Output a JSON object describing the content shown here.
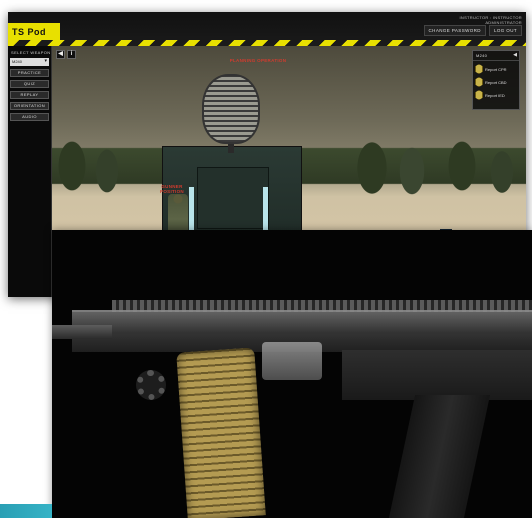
{
  "app": {
    "logo_text": "TS Pod",
    "instructor_label": "INSTRUCTOR : INSTRUCTOR",
    "instructor_sub": "ADMINISTRATOR",
    "links": [
      "CHANGE PASSWORD",
      "LOG OUT"
    ]
  },
  "sidebar": {
    "section_title": "SELECT WEAPON",
    "selected_weapon": "M240",
    "buttons": [
      "PRACTICE",
      "QUIZ",
      "REPLAY",
      "ORIENTATION",
      "AUDIO"
    ]
  },
  "viewport": {
    "callout_top": "PLANNING OPERATION",
    "callout_left": "GUNNER POSITION",
    "info_icon_glyph": "i",
    "back_icon_glyph": "◀"
  },
  "panel": {
    "title": "M240",
    "toggle_glyph": "◀",
    "items": [
      "Report CPR",
      "Report CBD",
      "Report IED"
    ]
  },
  "colors": {
    "stripe_yellow": "#e8e000",
    "callout_red": "#d23b2e",
    "accent_teal": "#2a9fb4"
  }
}
